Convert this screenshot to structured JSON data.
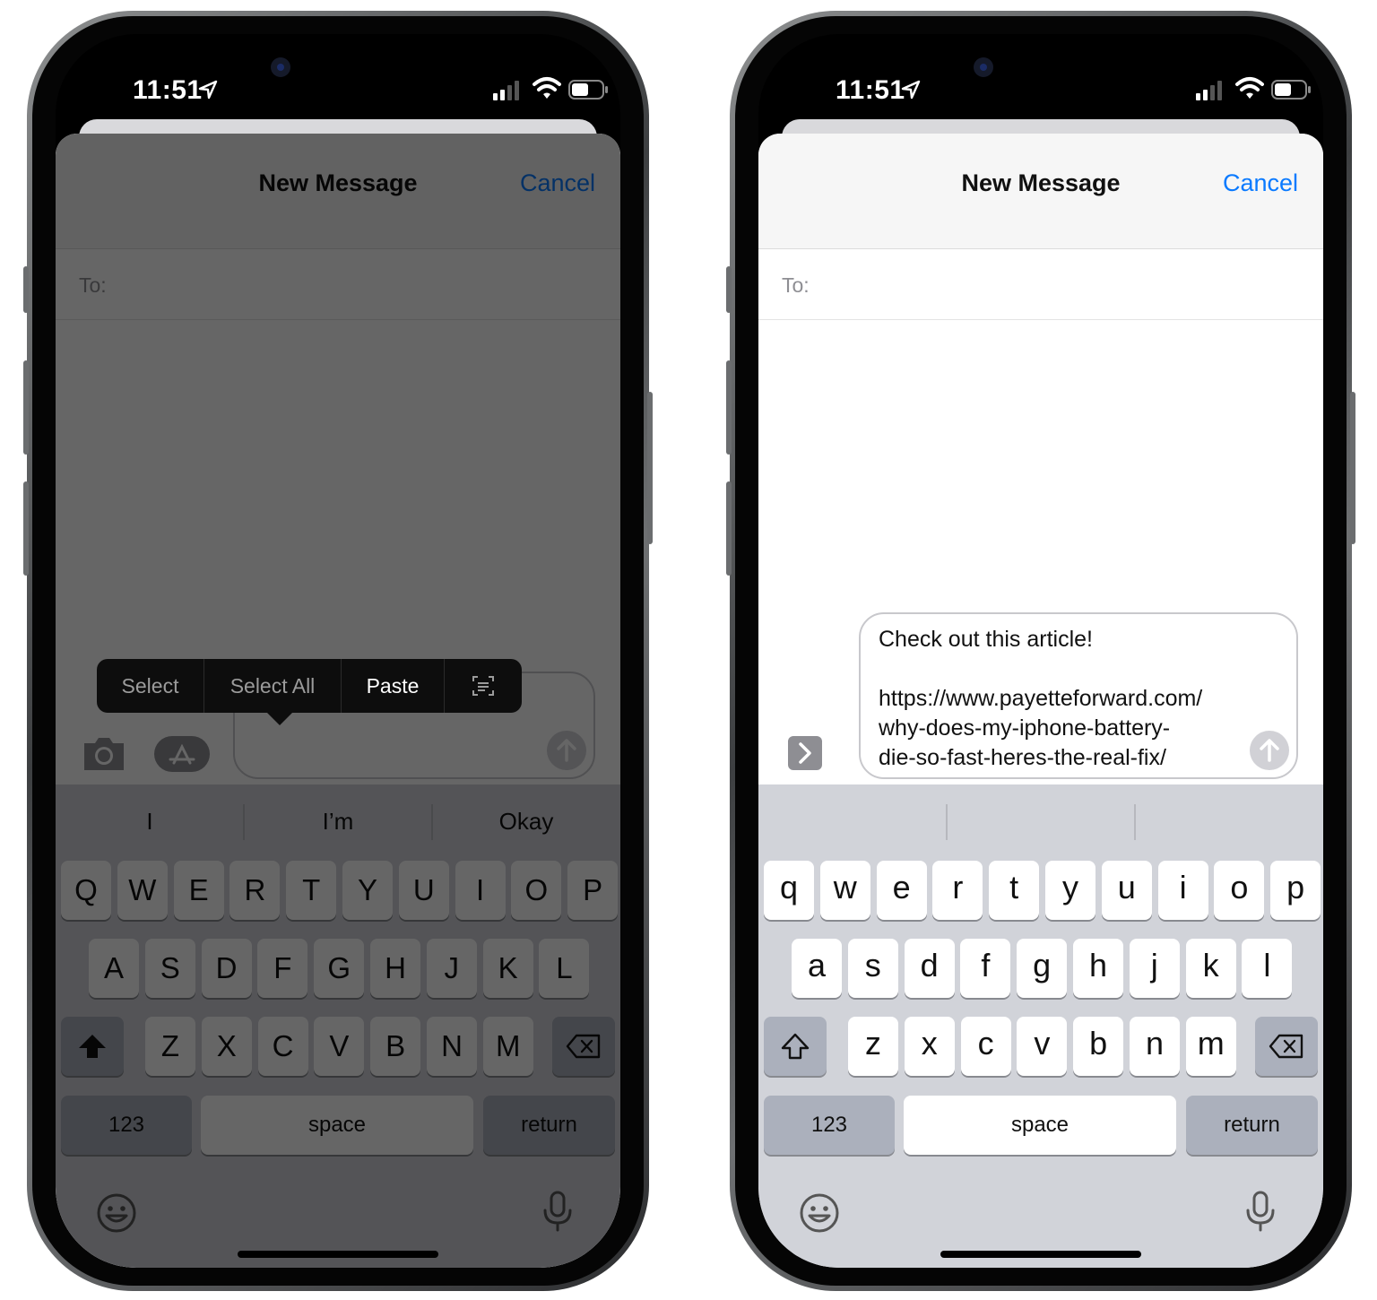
{
  "status": {
    "time": "11:51"
  },
  "compose": {
    "title": "New Message",
    "cancel_label": "Cancel",
    "to_label": "To:"
  },
  "left_screen": {
    "edit_menu": [
      {
        "label": "Select",
        "active": false
      },
      {
        "label": "Select All",
        "active": false
      },
      {
        "label": "Paste",
        "active": true
      },
      {
        "label": "scan-text-icon",
        "active": false
      }
    ],
    "suggestions": [
      "I",
      "I’m",
      "Okay"
    ],
    "keys": {
      "row1": [
        "Q",
        "W",
        "E",
        "R",
        "T",
        "Y",
        "U",
        "I",
        "O",
        "P"
      ],
      "row2": [
        "A",
        "S",
        "D",
        "F",
        "G",
        "H",
        "J",
        "K",
        "L"
      ],
      "row3": [
        "Z",
        "X",
        "C",
        "V",
        "B",
        "N",
        "M"
      ]
    }
  },
  "right_screen": {
    "message_text": "Check out this article!\n\nhttps://www.payetteforward.com/\nwhy-does-my-iphone-battery-\ndie-so-fast-heres-the-real-fix/",
    "suggestions": [
      "",
      "",
      ""
    ],
    "keys": {
      "row1": [
        "q",
        "w",
        "e",
        "r",
        "t",
        "y",
        "u",
        "i",
        "o",
        "p"
      ],
      "row2": [
        "a",
        "s",
        "d",
        "f",
        "g",
        "h",
        "j",
        "k",
        "l"
      ],
      "row3": [
        "z",
        "x",
        "c",
        "v",
        "b",
        "n",
        "m"
      ]
    }
  },
  "keyboard": {
    "numbers_label": "123",
    "space_label": "space",
    "return_label": "return"
  },
  "colors": {
    "accent": "#0a7aff",
    "keyboard_bg": "#d1d3d9",
    "function_key": "#abb0bc"
  }
}
